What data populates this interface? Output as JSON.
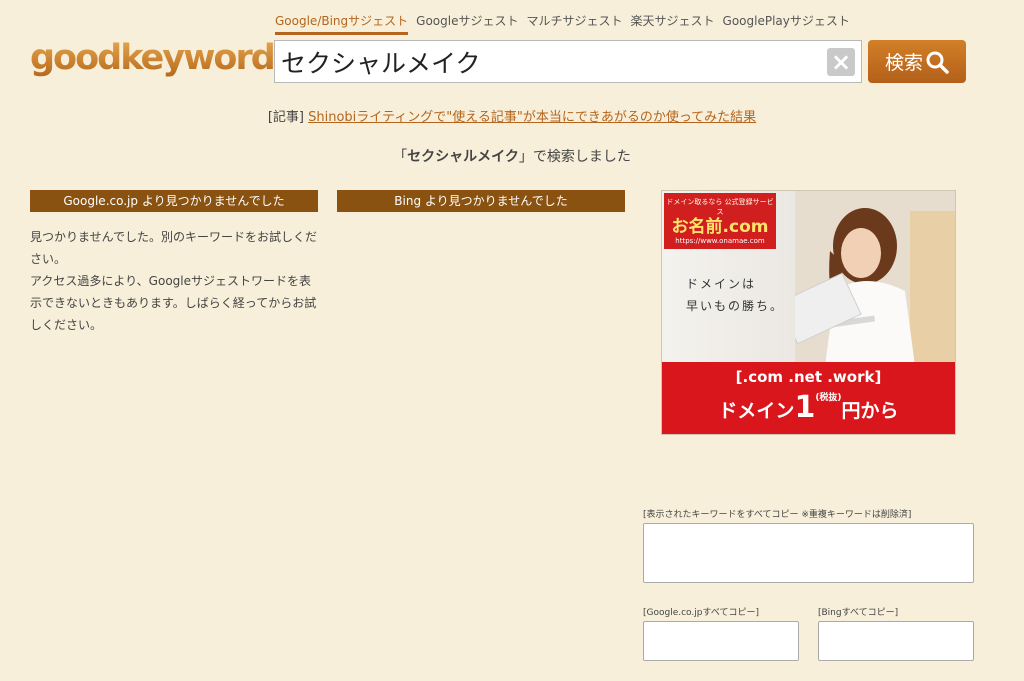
{
  "tabs": [
    {
      "label": "Google/Bingサジェスト",
      "active": true
    },
    {
      "label": "Googleサジェスト",
      "active": false
    },
    {
      "label": "マルチサジェスト",
      "active": false
    },
    {
      "label": "楽天サジェスト",
      "active": false
    },
    {
      "label": "GooglePlayサジェスト",
      "active": false
    }
  ],
  "logo": "goodkeyword",
  "search": {
    "value": "セクシャルメイク",
    "clear_icon": "close-icon",
    "button_label": "検索"
  },
  "article": {
    "prefix": "[記事]",
    "link_text": "Shinobiライティングで\"使える記事\"が本当にできあがるのか使ってみた結果"
  },
  "result": {
    "open": "「",
    "keyword": "セクシャルメイク",
    "close": "」で検索しました"
  },
  "google": {
    "header": "Google.co.jp より見つかりませんでした",
    "message_1": "見つかりませんでした。別のキーワードをお試しください。",
    "message_2": "アクセス過多により、Googleサジェストワードを表示できないときもあります。しばらく経ってからお試しください。"
  },
  "bing": {
    "header": "Bing より見つかりませんでした"
  },
  "ad": {
    "badge_small": "ドメイン取るなら 公式登録サービス",
    "badge_brand": "お名前.com",
    "badge_url": "https://www.onamae.com",
    "copy_line1": "ドメインは",
    "copy_line2": "早いもの勝ち。",
    "tlds": "[.com .net .work]",
    "price_pre": "ドメイン",
    "price_num": "1",
    "price_post": "円から",
    "price_note": "(税抜)"
  },
  "copy": {
    "all_label": "[表示されたキーワードをすべてコピー ※重複キーワードは削除済]",
    "google_label": "[Google.co.jpすべてコピー]",
    "bing_label": "[Bingすべてコピー]"
  },
  "colors": {
    "accent": "#b5651d",
    "header_bg": "#8a5210",
    "page_bg": "#f7efd9",
    "ad_red": "#d9161b"
  }
}
